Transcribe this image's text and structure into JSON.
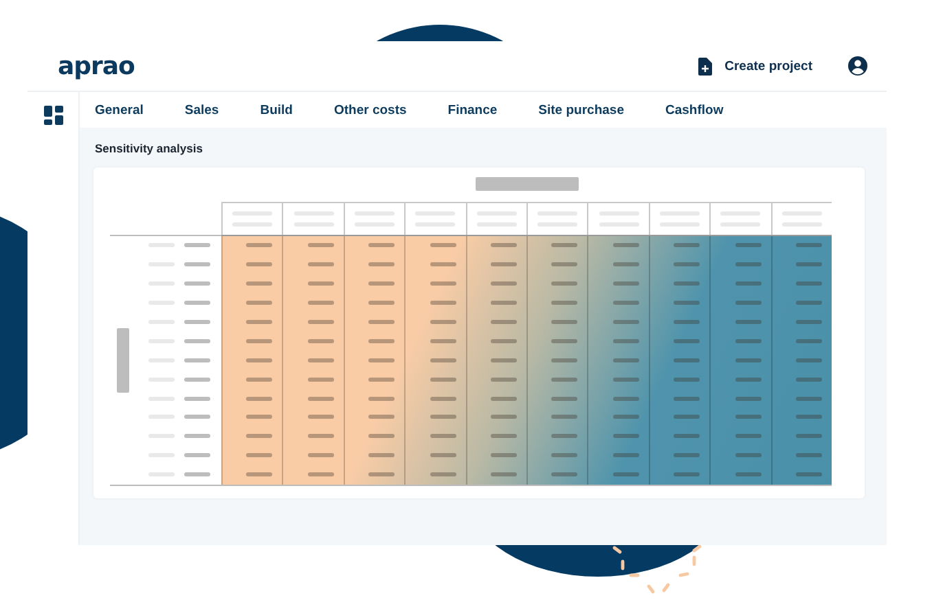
{
  "header": {
    "logo": "aprao",
    "create_button": "Create project"
  },
  "tabs": [
    {
      "label": "General"
    },
    {
      "label": "Sales"
    },
    {
      "label": "Build"
    },
    {
      "label": "Other costs"
    },
    {
      "label": "Finance"
    },
    {
      "label": "Site purchase"
    },
    {
      "label": "Cashflow"
    }
  ],
  "section": {
    "title": "Sensitivity analysis"
  }
}
